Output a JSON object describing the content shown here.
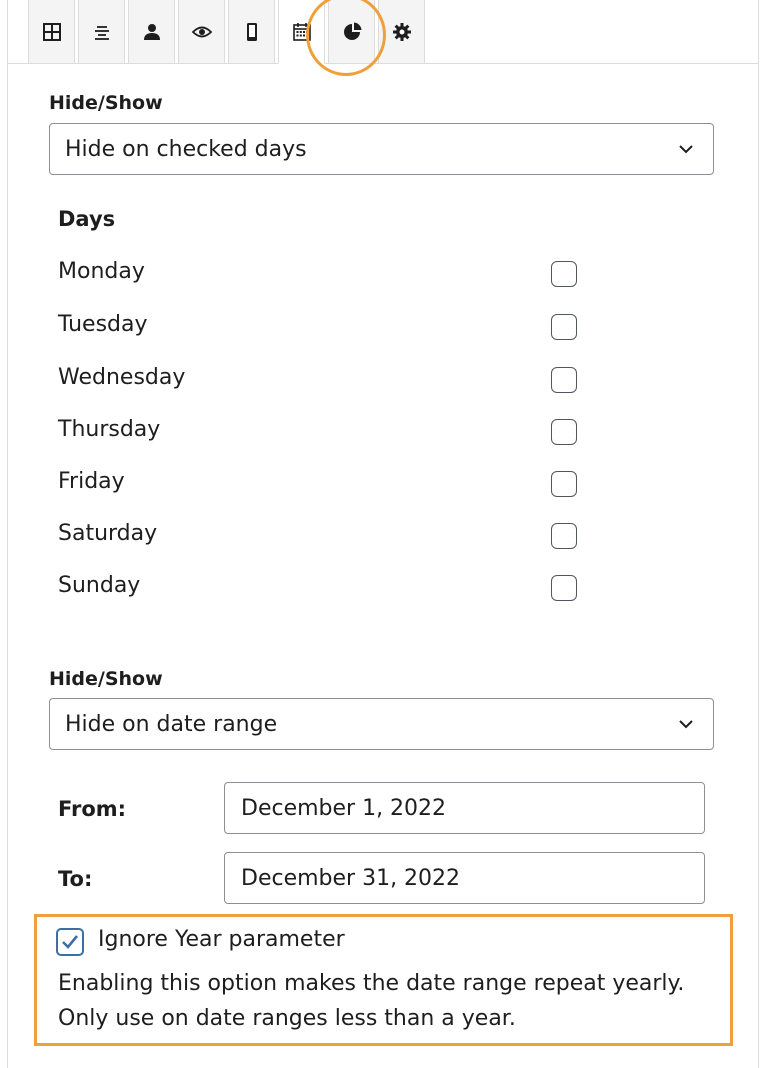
{
  "tabs": [
    {
      "icon": "grid-icon"
    },
    {
      "icon": "align-center-icon"
    },
    {
      "icon": "user-icon"
    },
    {
      "icon": "eye-icon"
    },
    {
      "icon": "mobile-icon"
    },
    {
      "icon": "calendar-icon",
      "active": true
    },
    {
      "icon": "pie-chart-icon"
    },
    {
      "icon": "gear-icon"
    }
  ],
  "highlight_color": "#f0a03a",
  "days_section": {
    "hide_show_label": "Hide/Show",
    "select_value": "Hide on checked days",
    "heading": "Days",
    "days": [
      {
        "label": "Monday",
        "checked": false
      },
      {
        "label": "Tuesday",
        "checked": false
      },
      {
        "label": "Wednesday",
        "checked": false
      },
      {
        "label": "Thursday",
        "checked": false
      },
      {
        "label": "Friday",
        "checked": false
      },
      {
        "label": "Saturday",
        "checked": false
      },
      {
        "label": "Sunday",
        "checked": false
      }
    ]
  },
  "date_section": {
    "hide_show_label": "Hide/Show",
    "select_value": "Hide on date range",
    "from_label": "From:",
    "from_value": "December 1, 2022",
    "to_label": "To:",
    "to_value": "December 31, 2022",
    "ignore_year_label": "Ignore Year parameter",
    "ignore_year_checked": true,
    "help_text": "Enabling this option makes the date range repeat yearly. Only use on date ranges less than a year."
  }
}
